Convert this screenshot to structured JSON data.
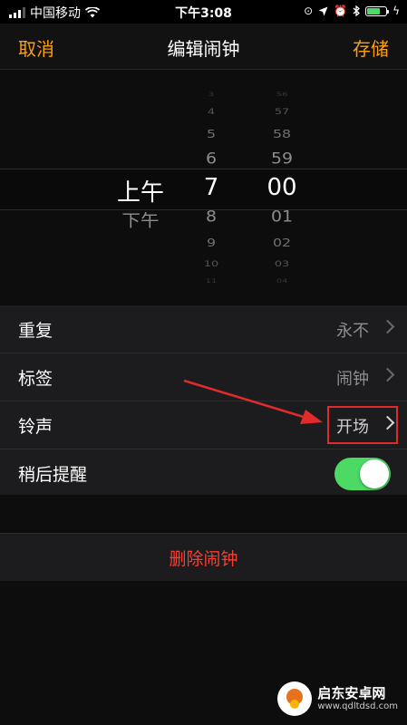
{
  "status_bar": {
    "carrier": "中国移动",
    "time": "下午3:08"
  },
  "nav": {
    "cancel": "取消",
    "title": "编辑闹钟",
    "save": "存储"
  },
  "picker": {
    "ampm": [
      {
        "text": "上午",
        "selected": true
      },
      {
        "text": "下午",
        "selected": false
      }
    ],
    "hours": [
      {
        "text": "3",
        "selected": false
      },
      {
        "text": "4",
        "selected": false
      },
      {
        "text": "5",
        "selected": false
      },
      {
        "text": "6",
        "selected": false
      },
      {
        "text": "7",
        "selected": true
      },
      {
        "text": "8",
        "selected": false
      },
      {
        "text": "9",
        "selected": false
      },
      {
        "text": "10",
        "selected": false
      },
      {
        "text": "11",
        "selected": false
      }
    ],
    "minutes": [
      {
        "text": "56",
        "selected": false
      },
      {
        "text": "57",
        "selected": false
      },
      {
        "text": "58",
        "selected": false
      },
      {
        "text": "59",
        "selected": false
      },
      {
        "text": "00",
        "selected": true
      },
      {
        "text": "01",
        "selected": false
      },
      {
        "text": "02",
        "selected": false
      },
      {
        "text": "03",
        "selected": false
      },
      {
        "text": "04",
        "selected": false
      }
    ]
  },
  "settings": {
    "repeat": {
      "label": "重复",
      "value": "永不"
    },
    "label": {
      "label": "标签",
      "value": "闹钟"
    },
    "sound": {
      "label": "铃声",
      "value": "开场"
    },
    "snooze": {
      "label": "稍后提醒",
      "on": true
    }
  },
  "delete_label": "删除闹钟",
  "watermark": {
    "name": "启东安卓网",
    "url": "www.qdltdsd.com"
  },
  "colors": {
    "accent": "#ff9f0a",
    "destructive": "#ff3b30",
    "toggle_on": "#4cd964",
    "annotation": "#e02b2b"
  }
}
